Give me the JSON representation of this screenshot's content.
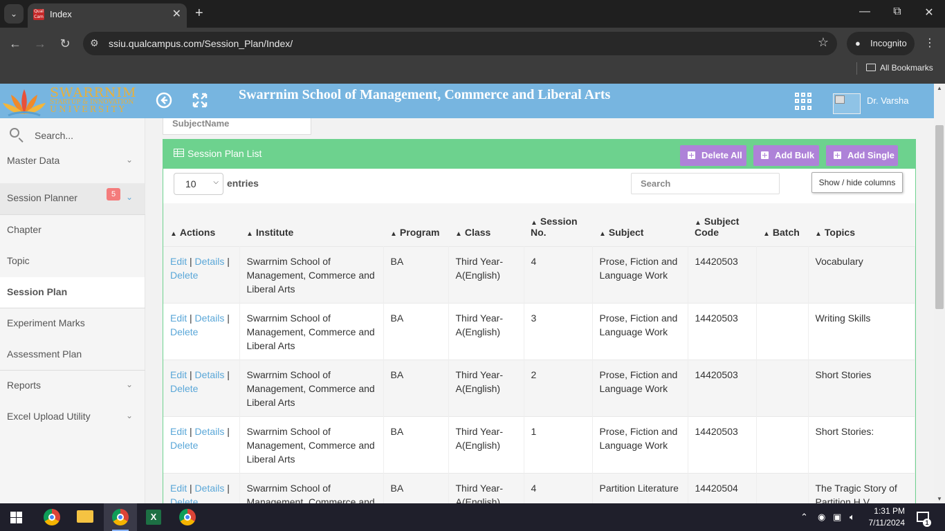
{
  "browser": {
    "tab_title": "Index",
    "url": "ssiu.qualcampus.com/Session_Plan/Index/",
    "profile_label": "Incognito",
    "bookmarks_label": "All Bookmarks"
  },
  "header": {
    "logo_line1": "SWARRNIM",
    "logo_line2": "STARTUP & INNOVATION",
    "logo_line3": "UNIVERSITY",
    "title": "Swarrnim School of Management, Commerce and Liberal Arts",
    "user_name": "Dr. Varsha"
  },
  "sidebar": {
    "search_placeholder": "Search...",
    "items": [
      {
        "label": "Master Data",
        "has_chevron": true
      },
      {
        "label": "Session Planner",
        "has_chevron": true,
        "badge": "5"
      },
      {
        "label": "Chapter"
      },
      {
        "label": "Topic"
      },
      {
        "label": "Session Plan"
      },
      {
        "label": "Experiment Marks"
      },
      {
        "label": "Assessment Plan"
      },
      {
        "label": "Reports",
        "has_chevron": true
      },
      {
        "label": "Excel Upload Utility",
        "has_chevron": true
      }
    ]
  },
  "filters": {
    "subject_name_placeholder": "SubjectName"
  },
  "panel": {
    "title": "Session Plan List",
    "buttons": {
      "delete_all": "Delete All",
      "add_bulk": "Add Bulk",
      "add_single": "Add Single"
    },
    "page_length": "10",
    "entries_label": "entries",
    "search_placeholder": "Search",
    "show_hide_label": "Show / hide columns"
  },
  "table": {
    "columns": [
      "Actions",
      "Institute",
      "Program",
      "Class",
      "Session No.",
      "Subject",
      "Subject Code",
      "Batch",
      "Topics"
    ],
    "action_links": {
      "edit": "Edit",
      "details": "Details",
      "delete": "Delete",
      "sep": "|"
    },
    "rows": [
      {
        "institute": "Swarrnim School of Management, Commerce and Liberal Arts",
        "program": "BA",
        "class": "Third Year-A(English)",
        "session_no": "4",
        "subject": "Prose, Fiction and Language Work",
        "subject_code": "14420503",
        "batch": "",
        "topics": "Vocabulary"
      },
      {
        "institute": "Swarrnim School of Management, Commerce and Liberal Arts",
        "program": "BA",
        "class": "Third Year-A(English)",
        "session_no": "3",
        "subject": "Prose, Fiction and Language Work",
        "subject_code": "14420503",
        "batch": "",
        "topics": "Writing Skills"
      },
      {
        "institute": "Swarrnim School of Management, Commerce and Liberal Arts",
        "program": "BA",
        "class": "Third Year-A(English)",
        "session_no": "2",
        "subject": "Prose, Fiction and Language Work",
        "subject_code": "14420503",
        "batch": "",
        "topics": "Short Stories"
      },
      {
        "institute": "Swarrnim School of Management, Commerce and Liberal Arts",
        "program": "BA",
        "class": "Third Year-A(English)",
        "session_no": "1",
        "subject": "Prose, Fiction and Language Work",
        "subject_code": "14420503",
        "batch": "",
        "topics": "Short Stories:"
      },
      {
        "institute": "Swarrnim School of Management, Commerce and Liberal Arts",
        "program": "BA",
        "class": "Third Year-A(English)",
        "session_no": "4",
        "subject": "Partition Literature",
        "subject_code": "14420504",
        "batch": "",
        "topics": "The Tragic Story of Partition H V"
      }
    ]
  },
  "taskbar": {
    "time": "1:31 PM",
    "date": "7/11/2024",
    "notification_count": "1"
  },
  "colors": {
    "header_bg": "#77b5e0",
    "panel_green": "#6dd28e",
    "button_purple": "#ae82d8",
    "link_blue": "#5aa7d8",
    "badge_red": "#f47c7c"
  }
}
